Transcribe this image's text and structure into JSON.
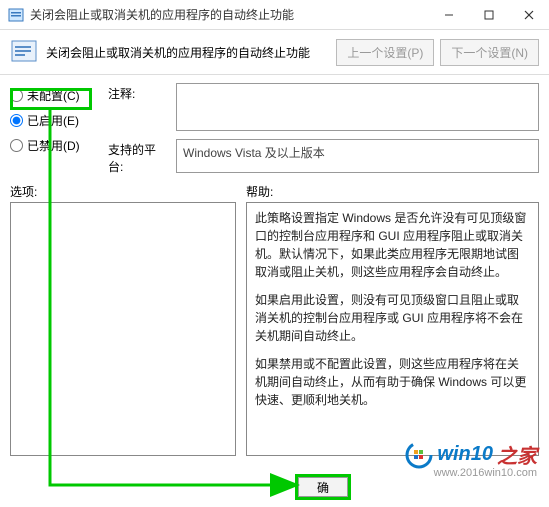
{
  "window": {
    "title": "关闭会阻止或取消关机的应用程序的自动终止功能"
  },
  "header": {
    "title": "关闭会阻止或取消关机的应用程序的自动终止功能",
    "prev": "上一个设置(P)",
    "next": "下一个设置(N)"
  },
  "radios": {
    "not_configured": "未配置(C)",
    "enabled": "已启用(E)",
    "disabled": "已禁用(D)"
  },
  "fields": {
    "comment_label": "注释:",
    "comment_value": "",
    "platform_label": "支持的平台:",
    "platform_value": "Windows Vista 及以上版本"
  },
  "lower": {
    "options_label": "选项:",
    "help_label": "帮助:"
  },
  "help": {
    "p1": "此策略设置指定 Windows 是否允许没有可见顶级窗口的控制台应用程序和 GUI 应用程序阻止或取消关机。默认情况下，如果此类应用程序无限期地试图取消或阻止关机，则这些应用程序会自动终止。",
    "p2": "如果启用此设置，则没有可见顶级窗口且阻止或取消关机的控制台应用程序或 GUI 应用程序将不会在关机期间自动终止。",
    "p3": "如果禁用或不配置此设置，则这些应用程序将在关机期间自动终止，从而有助于确保 Windows 可以更快速、更顺利地关机。"
  },
  "buttons": {
    "ok": "确"
  },
  "watermark": {
    "w1": "win10",
    "w2": "之家",
    "url": "www.2016win10.com"
  }
}
